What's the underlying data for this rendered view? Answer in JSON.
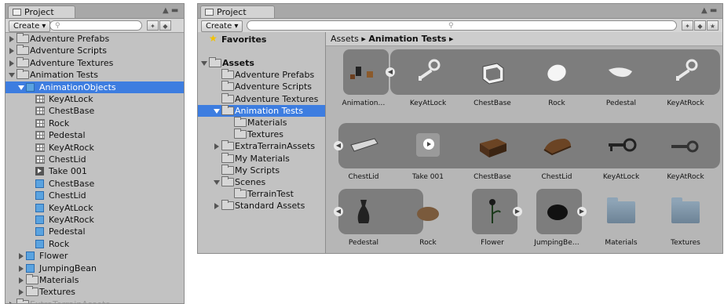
{
  "left": {
    "tab": "Project",
    "create_label": "Create",
    "search_placeholder": "",
    "tree": [
      {
        "label": "Adventure Prefabs",
        "depth": 0,
        "icon": "folder",
        "arrow": "right"
      },
      {
        "label": "Adventure Scripts",
        "depth": 0,
        "icon": "folder",
        "arrow": "right"
      },
      {
        "label": "Adventure Textures",
        "depth": 0,
        "icon": "folder",
        "arrow": "right"
      },
      {
        "label": "Animation Tests",
        "depth": 0,
        "icon": "folder",
        "arrow": "down"
      },
      {
        "label": "AnimationObjects",
        "depth": 1,
        "icon": "prefab",
        "arrow": "down",
        "selected": true
      },
      {
        "label": "KeyAtLock",
        "depth": 2,
        "icon": "mesh"
      },
      {
        "label": "ChestBase",
        "depth": 2,
        "icon": "mesh"
      },
      {
        "label": "Rock",
        "depth": 2,
        "icon": "mesh"
      },
      {
        "label": "Pedestal",
        "depth": 2,
        "icon": "mesh"
      },
      {
        "label": "KeyAtRock",
        "depth": 2,
        "icon": "mesh"
      },
      {
        "label": "ChestLid",
        "depth": 2,
        "icon": "mesh"
      },
      {
        "label": "Take 001",
        "depth": 2,
        "icon": "clip"
      },
      {
        "label": "ChestBase",
        "depth": 2,
        "icon": "cube"
      },
      {
        "label": "ChestLid",
        "depth": 2,
        "icon": "cube"
      },
      {
        "label": "KeyAtLock",
        "depth": 2,
        "icon": "cube"
      },
      {
        "label": "KeyAtRock",
        "depth": 2,
        "icon": "cube"
      },
      {
        "label": "Pedestal",
        "depth": 2,
        "icon": "cube"
      },
      {
        "label": "Rock",
        "depth": 2,
        "icon": "cube"
      },
      {
        "label": "Flower",
        "depth": 1,
        "icon": "prefab",
        "arrow": "right"
      },
      {
        "label": "JumpingBean",
        "depth": 1,
        "icon": "prefab",
        "arrow": "right"
      },
      {
        "label": "Materials",
        "depth": 1,
        "icon": "folder",
        "arrow": "right"
      },
      {
        "label": "Textures",
        "depth": 1,
        "icon": "folder",
        "arrow": "right"
      },
      {
        "label": "ExtraTerrainAssets",
        "depth": 0,
        "icon": "folder",
        "arrow": "right",
        "faded": true
      }
    ]
  },
  "right": {
    "tab": "Project",
    "create_label": "Create",
    "favorites_label": "Favorites",
    "tree": [
      {
        "label": "Assets",
        "depth": 0,
        "icon": "folder",
        "arrow": "down",
        "bold": true
      },
      {
        "label": "Adventure Prefabs",
        "depth": 1,
        "icon": "folder"
      },
      {
        "label": "Adventure Scripts",
        "depth": 1,
        "icon": "folder"
      },
      {
        "label": "Adventure Textures",
        "depth": 1,
        "icon": "folder"
      },
      {
        "label": "Animation Tests",
        "depth": 1,
        "icon": "folder",
        "arrow": "down",
        "selected": true
      },
      {
        "label": "Materials",
        "depth": 2,
        "icon": "folder"
      },
      {
        "label": "Textures",
        "depth": 2,
        "icon": "folder"
      },
      {
        "label": "ExtraTerrainAssets",
        "depth": 1,
        "icon": "folder",
        "arrow": "right"
      },
      {
        "label": "My Materials",
        "depth": 1,
        "icon": "folder"
      },
      {
        "label": "My Scripts",
        "depth": 1,
        "icon": "folder"
      },
      {
        "label": "Scenes",
        "depth": 1,
        "icon": "folder",
        "arrow": "down"
      },
      {
        "label": "TerrainTest",
        "depth": 2,
        "icon": "folder"
      },
      {
        "label": "Standard Assets",
        "depth": 1,
        "icon": "folder",
        "arrow": "right"
      }
    ],
    "breadcrumb": {
      "root": "Assets",
      "current": "Animation Tests"
    },
    "grid_rows": [
      [
        "Animation…",
        "KeyAtLock",
        "ChestBase",
        "Rock",
        "Pedestal",
        "KeyAtRock"
      ],
      [
        "ChestLid",
        "Take 001",
        "ChestBase",
        "ChestLid",
        "KeyAtLock",
        "KeyAtRock"
      ],
      [
        "Pedestal",
        "Rock",
        "Flower",
        "JumpingBe…",
        "Materials",
        "Textures"
      ]
    ]
  }
}
